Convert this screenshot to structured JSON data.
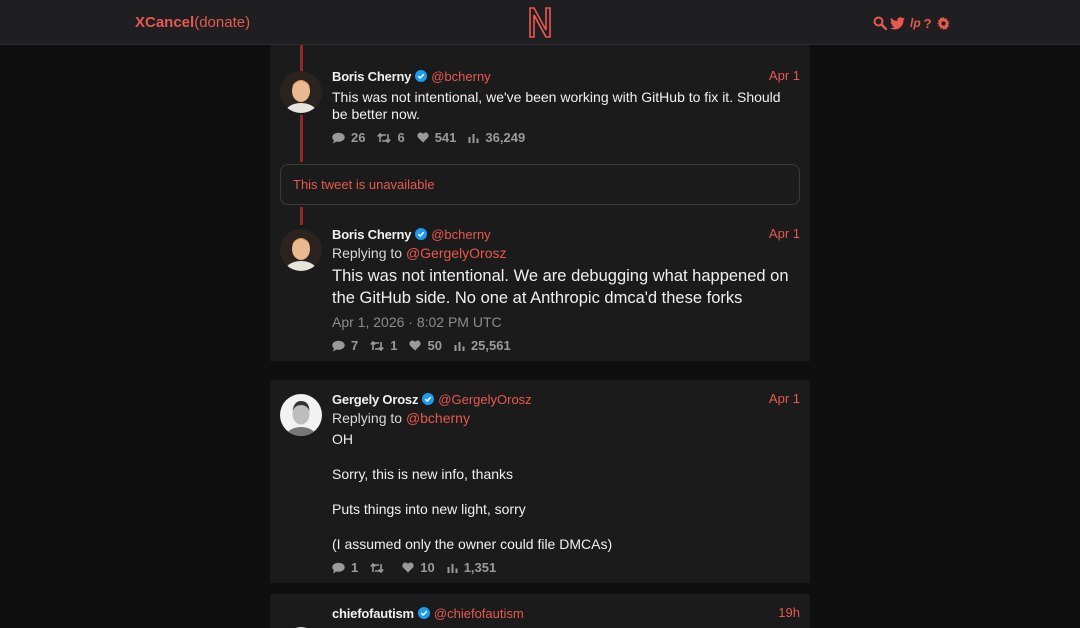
{
  "nav": {
    "brand_name": "XCancel",
    "brand_suffix": "(donate)",
    "logo_letter": "N",
    "icons": [
      "search-icon",
      "bird-icon",
      "lp-icon",
      "help-icon",
      "gear-icon"
    ],
    "lp_label": "lp",
    "help_label": "?"
  },
  "colors": {
    "accent": "#e8584f",
    "background": "#0f0f10",
    "panel": "#1b1b1c",
    "thread_line": "#8e2b2a",
    "verified": "#1d9bf0"
  },
  "tweets": [
    {
      "fullname": "Boris Cherny",
      "username": "@bcherny",
      "date": "Apr 1",
      "text": "This was not intentional, we've been working with GitHub to fix it. Should be better now.",
      "replies": "26",
      "retweets": "6",
      "likes": "541",
      "views": "36,249"
    },
    {
      "unavailable": "This tweet is unavailable"
    },
    {
      "fullname": "Boris Cherny",
      "username": "@bcherny",
      "date": "Apr 1",
      "replying_label": "Replying to",
      "replying_to": "@GergelyOrosz",
      "text": "This was not intentional. We are debugging what happened on the GitHub side. No one at Anthropic dmca'd these forks",
      "timestamp": "Apr 1, 2026 · 8:02 PM UTC",
      "replies": "7",
      "retweets": "1",
      "likes": "50",
      "views": "25,561"
    },
    {
      "fullname": "Gergely Orosz",
      "username": "@GergelyOrosz",
      "date": "Apr 1",
      "replying_label": "Replying to",
      "replying_to": "@bcherny",
      "paragraphs": [
        "OH",
        "Sorry, this is new info, thanks",
        "Puts things into new light, sorry",
        "(I assumed only the owner could file DMCAs)"
      ],
      "replies": "1",
      "retweets": "",
      "likes": "10",
      "views": "1,351"
    },
    {
      "fullname": "chiefofautism",
      "username": "@chiefofautism",
      "date": "19h"
    }
  ]
}
